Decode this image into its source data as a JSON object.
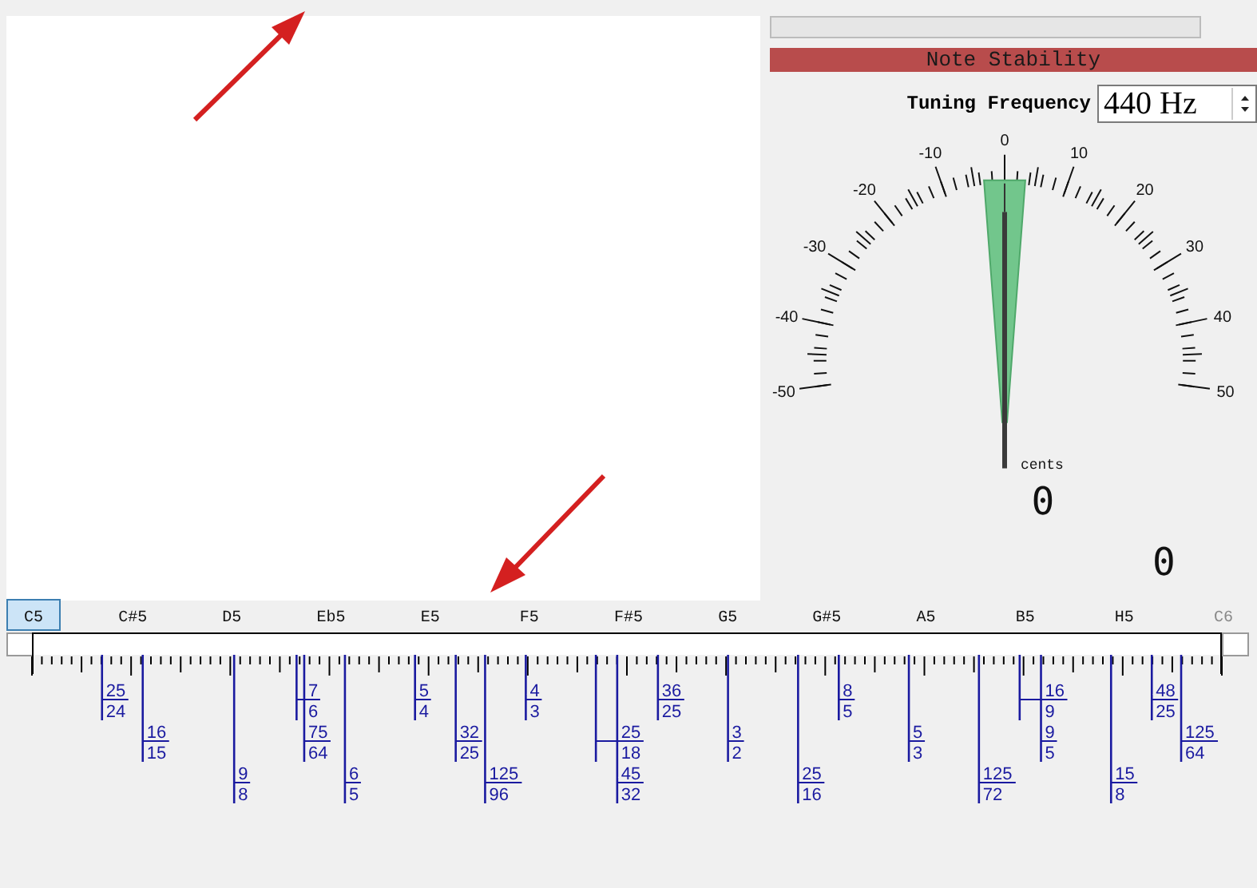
{
  "stability": {
    "title": "Note Stability"
  },
  "tuning": {
    "label": "Tuning Frequency",
    "value": "440 Hz"
  },
  "meter": {
    "scale_labels": [
      "-50",
      "-40",
      "-30",
      "-20",
      "-10",
      "0",
      "10",
      "20",
      "30",
      "40",
      "50"
    ],
    "unit": "cents",
    "reading": "0"
  },
  "secondary_reading": "0",
  "notes": [
    {
      "label": "C5",
      "selected": true,
      "disabled": false
    },
    {
      "label": "C#5",
      "selected": false,
      "disabled": false
    },
    {
      "label": "D5",
      "selected": false,
      "disabled": false
    },
    {
      "label": "Eb5",
      "selected": false,
      "disabled": false
    },
    {
      "label": "E5",
      "selected": false,
      "disabled": false
    },
    {
      "label": "F5",
      "selected": false,
      "disabled": false
    },
    {
      "label": "F#5",
      "selected": false,
      "disabled": false
    },
    {
      "label": "G5",
      "selected": false,
      "disabled": false
    },
    {
      "label": "G#5",
      "selected": false,
      "disabled": false
    },
    {
      "label": "A5",
      "selected": false,
      "disabled": false
    },
    {
      "label": "B5",
      "selected": false,
      "disabled": false
    },
    {
      "label": "H5",
      "selected": false,
      "disabled": false
    },
    {
      "label": "C6",
      "selected": false,
      "disabled": true
    }
  ],
  "ratios": [
    {
      "num": "25",
      "den": "24"
    },
    {
      "num": "16",
      "den": "15"
    },
    {
      "num": "9",
      "den": "8"
    },
    {
      "num": "7",
      "den": "6"
    },
    {
      "num": "75",
      "den": "64"
    },
    {
      "num": "6",
      "den": "5"
    },
    {
      "num": "5",
      "den": "4"
    },
    {
      "num": "32",
      "den": "25"
    },
    {
      "num": "125",
      "den": "96"
    },
    {
      "num": "4",
      "den": "3"
    },
    {
      "num": "25",
      "den": "18"
    },
    {
      "num": "45",
      "den": "32"
    },
    {
      "num": "36",
      "den": "25"
    },
    {
      "num": "3",
      "den": "2"
    },
    {
      "num": "25",
      "den": "16"
    },
    {
      "num": "8",
      "den": "5"
    },
    {
      "num": "5",
      "den": "3"
    },
    {
      "num": "125",
      "den": "72"
    },
    {
      "num": "16",
      "den": "9"
    },
    {
      "num": "9",
      "den": "5"
    },
    {
      "num": "15",
      "den": "8"
    },
    {
      "num": "48",
      "den": "25"
    },
    {
      "num": "125",
      "den": "64"
    }
  ]
}
